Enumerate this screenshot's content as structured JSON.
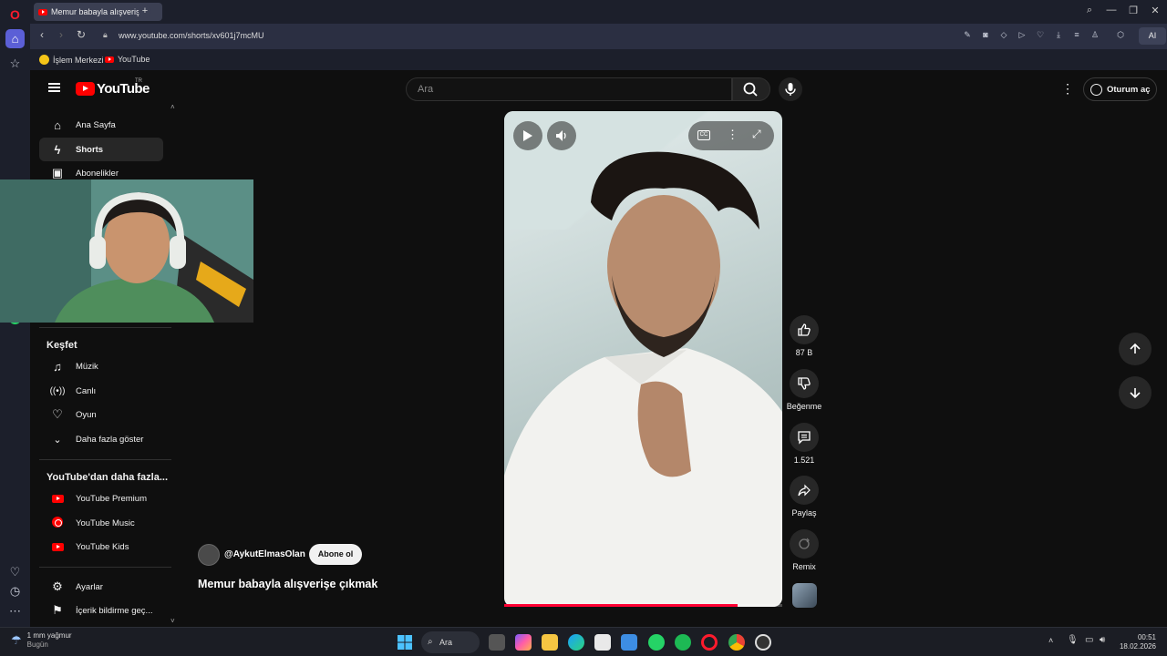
{
  "browser": {
    "tab_title": "Memur babayla alışverişe",
    "url": "www.youtube.com/shorts/xv601j7mcMU",
    "ai_label": "AI",
    "bookmarks": [
      "İşlem Merkezi",
      "YouTube"
    ]
  },
  "header": {
    "logo_text": "YouTube",
    "region": "TR",
    "search_placeholder": "Ara",
    "signin_label": "Oturum aç"
  },
  "sidebar": {
    "items": [
      {
        "label": "Ana Sayfa",
        "icon": "home-icon"
      },
      {
        "label": "Shorts",
        "icon": "shorts-icon"
      },
      {
        "label": "Abonelikler",
        "icon": "subscriptions-icon"
      }
    ],
    "explore_title": "Keşfet",
    "explore": [
      {
        "label": "Müzik",
        "icon": "music-icon"
      },
      {
        "label": "Canlı",
        "icon": "live-icon"
      },
      {
        "label": "Oyun",
        "icon": "gaming-icon"
      },
      {
        "label": "Daha fazla göster",
        "icon": "chevron-down-icon"
      }
    ],
    "more_title": "YouTube'dan daha fazla...",
    "more": [
      {
        "label": "YouTube Premium"
      },
      {
        "label": "YouTube Music"
      },
      {
        "label": "YouTube Kids"
      }
    ],
    "settings": [
      {
        "label": "Ayarlar",
        "icon": "settings-icon"
      },
      {
        "label": "İçerik bildirme geç...",
        "icon": "flag-icon"
      }
    ]
  },
  "video": {
    "channel": "@AykutElmasOlan",
    "subscribe_label": "Abone ol",
    "title": "Memur babayla alışverişe çıkmak",
    "progress": 0.84
  },
  "actions": {
    "likes": "87 B",
    "dislike_label": "Beğenme",
    "comments": "1.521",
    "share_label": "Paylaş",
    "remix_label": "Remix"
  },
  "taskbar": {
    "weather_line1": "1 mm yağmur",
    "weather_line2": "Bugün",
    "search_label": "Ara",
    "time": "00:51",
    "date": "18.02.2026"
  },
  "colors": {
    "brand_red": "#ff0000",
    "background": "#0f0f0f",
    "opera_frame": "#1c1f2b"
  }
}
